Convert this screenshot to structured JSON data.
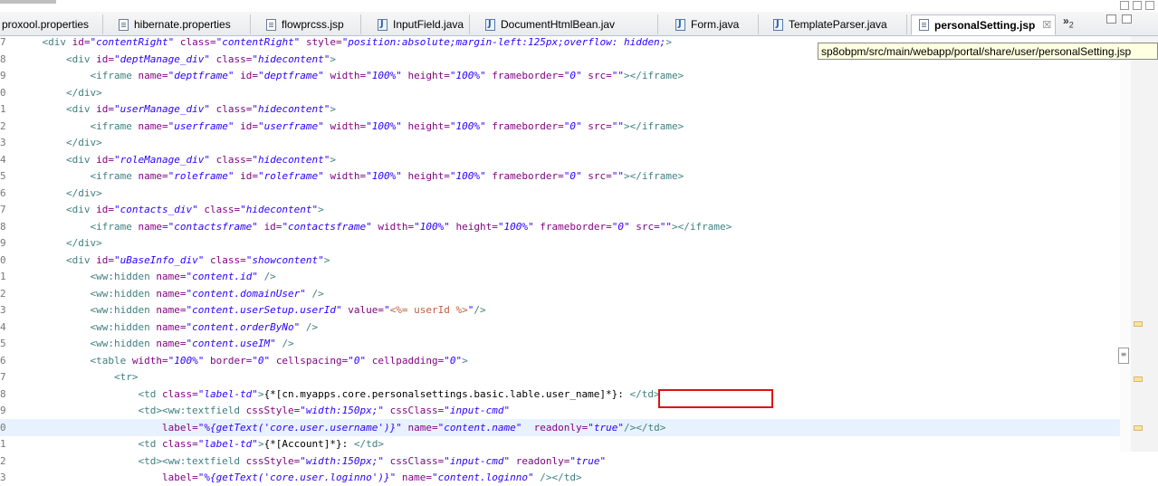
{
  "tabs": [
    {
      "label": "proxool.properties",
      "icon": "properties-file-icon",
      "icon_class": "props",
      "active": false
    },
    {
      "label": "hibernate.properties",
      "icon": "properties-file-icon",
      "icon_class": "props",
      "active": false
    },
    {
      "label": "flowprcss.jsp",
      "icon": "jsp-file-icon",
      "icon_class": "jsp",
      "active": false
    },
    {
      "label": "InputField.java",
      "icon": "java-file-icon",
      "icon_class": "java",
      "active": false
    },
    {
      "label": "DocumentHtmlBean.jav",
      "icon": "java-file-icon",
      "icon_class": "java",
      "active": false
    },
    {
      "label": "Form.java",
      "icon": "java-file-icon",
      "icon_class": "java",
      "active": false
    },
    {
      "label": "TemplateParser.java",
      "icon": "java-file-icon",
      "icon_class": "java",
      "active": false
    },
    {
      "label": "personalSetting.jsp",
      "icon": "jsp-file-icon",
      "icon_class": "jsp",
      "active": true,
      "close": "☒"
    }
  ],
  "overflow": {
    "chevron": "»",
    "count": "2"
  },
  "tooltip": "sp8obpm/src/main/webapp/portal/share/user/personalSetting.jsp",
  "lines": [
    {
      "num": "7",
      "tokens": [
        [
          "t",
          "    "
        ],
        [
          "tg",
          "<div "
        ],
        [
          "at",
          "id="
        ],
        [
          "vl",
          "\"contentRight\" "
        ],
        [
          "at",
          "class="
        ],
        [
          "vl",
          "\"contentRight\" "
        ],
        [
          "at",
          "style="
        ],
        [
          "vl",
          "\"position:absolute;margin-left:125px;overflow: hidden;"
        ],
        [
          "tg",
          ">"
        ]
      ]
    },
    {
      "num": "8",
      "tokens": [
        [
          "t",
          "        "
        ],
        [
          "tg",
          "<div "
        ],
        [
          "at",
          "id="
        ],
        [
          "vl",
          "\"deptManage_div\" "
        ],
        [
          "at",
          "class="
        ],
        [
          "vl",
          "\"hidecontent\""
        ],
        [
          "tg",
          ">"
        ]
      ]
    },
    {
      "num": "9",
      "tokens": [
        [
          "t",
          "            "
        ],
        [
          "tg",
          "<iframe "
        ],
        [
          "at",
          "name="
        ],
        [
          "vl",
          "\"deptframe\" "
        ],
        [
          "at",
          "id="
        ],
        [
          "vl",
          "\"deptframe\" "
        ],
        [
          "at",
          "width="
        ],
        [
          "vl",
          "\"100%\" "
        ],
        [
          "at",
          "height="
        ],
        [
          "vl",
          "\"100%\" "
        ],
        [
          "at",
          "frameborder="
        ],
        [
          "vl",
          "\"0\" "
        ],
        [
          "at",
          "src="
        ],
        [
          "vl",
          "\"\""
        ],
        [
          "tg",
          "></iframe>"
        ]
      ]
    },
    {
      "num": "0",
      "tokens": [
        [
          "t",
          "        "
        ],
        [
          "tg",
          "</div>"
        ]
      ]
    },
    {
      "num": "1",
      "tokens": [
        [
          "t",
          "        "
        ],
        [
          "tg",
          "<div "
        ],
        [
          "at",
          "id="
        ],
        [
          "vl",
          "\"userManage_div\" "
        ],
        [
          "at",
          "class="
        ],
        [
          "vl",
          "\"hidecontent\""
        ],
        [
          "tg",
          ">"
        ]
      ]
    },
    {
      "num": "2",
      "tokens": [
        [
          "t",
          "            "
        ],
        [
          "tg",
          "<iframe "
        ],
        [
          "at",
          "name="
        ],
        [
          "vl",
          "\"userframe\" "
        ],
        [
          "at",
          "id="
        ],
        [
          "vl",
          "\"userframe\" "
        ],
        [
          "at",
          "width="
        ],
        [
          "vl",
          "\"100%\" "
        ],
        [
          "at",
          "height="
        ],
        [
          "vl",
          "\"100%\" "
        ],
        [
          "at",
          "frameborder="
        ],
        [
          "vl",
          "\"0\" "
        ],
        [
          "at",
          "src="
        ],
        [
          "vl",
          "\"\""
        ],
        [
          "tg",
          "></iframe>"
        ]
      ]
    },
    {
      "num": "3",
      "tokens": [
        [
          "t",
          "        "
        ],
        [
          "tg",
          "</div>"
        ]
      ]
    },
    {
      "num": "4",
      "tokens": [
        [
          "t",
          "        "
        ],
        [
          "tg",
          "<div "
        ],
        [
          "at",
          "id="
        ],
        [
          "vl",
          "\"roleManage_div\" "
        ],
        [
          "at",
          "class="
        ],
        [
          "vl",
          "\"hidecontent\""
        ],
        [
          "tg",
          ">"
        ]
      ]
    },
    {
      "num": "5",
      "tokens": [
        [
          "t",
          "            "
        ],
        [
          "tg",
          "<iframe "
        ],
        [
          "at",
          "name="
        ],
        [
          "vl",
          "\"roleframe\" "
        ],
        [
          "at",
          "id="
        ],
        [
          "vl",
          "\"roleframe\" "
        ],
        [
          "at",
          "width="
        ],
        [
          "vl",
          "\"100%\" "
        ],
        [
          "at",
          "height="
        ],
        [
          "vl",
          "\"100%\" "
        ],
        [
          "at",
          "frameborder="
        ],
        [
          "vl",
          "\"0\" "
        ],
        [
          "at",
          "src="
        ],
        [
          "vl",
          "\"\""
        ],
        [
          "tg",
          "></iframe>"
        ]
      ]
    },
    {
      "num": "6",
      "tokens": [
        [
          "t",
          "        "
        ],
        [
          "tg",
          "</div>"
        ]
      ]
    },
    {
      "num": "7",
      "tokens": [
        [
          "t",
          "        "
        ],
        [
          "tg",
          "<div "
        ],
        [
          "at",
          "id="
        ],
        [
          "vl",
          "\"contacts_div\" "
        ],
        [
          "at",
          "class="
        ],
        [
          "vl",
          "\"hidecontent\""
        ],
        [
          "tg",
          ">"
        ]
      ]
    },
    {
      "num": "8",
      "tokens": [
        [
          "t",
          "            "
        ],
        [
          "tg",
          "<iframe "
        ],
        [
          "at",
          "name="
        ],
        [
          "vl",
          "\"contactsframe\" "
        ],
        [
          "at",
          "id="
        ],
        [
          "vl",
          "\"contactsframe\" "
        ],
        [
          "at",
          "width="
        ],
        [
          "vl",
          "\"100%\" "
        ],
        [
          "at",
          "height="
        ],
        [
          "vl",
          "\"100%\" "
        ],
        [
          "at",
          "frameborder="
        ],
        [
          "vl",
          "\"0\" "
        ],
        [
          "at",
          "src="
        ],
        [
          "vl",
          "\"\""
        ],
        [
          "tg",
          "></iframe>"
        ]
      ]
    },
    {
      "num": "9",
      "tokens": [
        [
          "t",
          "        "
        ],
        [
          "tg",
          "</div>"
        ]
      ]
    },
    {
      "num": "0",
      "tokens": [
        [
          "t",
          "        "
        ],
        [
          "tg",
          "<div "
        ],
        [
          "at",
          "id="
        ],
        [
          "vl",
          "\"uBaseInfo_div\" "
        ],
        [
          "at",
          "class="
        ],
        [
          "vl",
          "\"showcontent\""
        ],
        [
          "tg",
          ">"
        ]
      ]
    },
    {
      "num": "1",
      "tokens": [
        [
          "t",
          "            "
        ],
        [
          "tg",
          "<ww:hidden "
        ],
        [
          "at",
          "name="
        ],
        [
          "vl",
          "\"content.id\" "
        ],
        [
          "tg",
          "/>"
        ]
      ]
    },
    {
      "num": "2",
      "tokens": [
        [
          "t",
          "            "
        ],
        [
          "tg",
          "<ww:hidden "
        ],
        [
          "at",
          "name="
        ],
        [
          "vl",
          "\"content.domainUser\" "
        ],
        [
          "tg",
          "/>"
        ]
      ]
    },
    {
      "num": "3",
      "tokens": [
        [
          "t",
          "            "
        ],
        [
          "tg",
          "<ww:hidden "
        ],
        [
          "at",
          "name="
        ],
        [
          "vl",
          "\"content.userSetup.userId\" "
        ],
        [
          "at",
          "value="
        ],
        [
          "vl",
          "\""
        ],
        [
          "sc",
          "<%= userId %>"
        ],
        [
          "vl",
          "\""
        ],
        [
          "tg",
          "/>"
        ]
      ]
    },
    {
      "num": "4",
      "tokens": [
        [
          "t",
          "            "
        ],
        [
          "tg",
          "<ww:hidden "
        ],
        [
          "at",
          "name="
        ],
        [
          "vl",
          "\"content.orderByNo\" "
        ],
        [
          "tg",
          "/>"
        ]
      ]
    },
    {
      "num": "5",
      "tokens": [
        [
          "t",
          "            "
        ],
        [
          "tg",
          "<ww:hidden "
        ],
        [
          "at",
          "name="
        ],
        [
          "vl",
          "\"content.useIM\" "
        ],
        [
          "tg",
          "/>"
        ]
      ]
    },
    {
      "num": "6",
      "tokens": [
        [
          "t",
          "            "
        ],
        [
          "tg",
          "<table "
        ],
        [
          "at",
          "width="
        ],
        [
          "vl",
          "\"100%\" "
        ],
        [
          "at",
          "border="
        ],
        [
          "vl",
          "\"0\" "
        ],
        [
          "at",
          "cellspacing="
        ],
        [
          "vl",
          "\"0\" "
        ],
        [
          "at",
          "cellpadding="
        ],
        [
          "vl",
          "\"0\""
        ],
        [
          "tg",
          ">"
        ]
      ]
    },
    {
      "num": "7",
      "tokens": [
        [
          "t",
          "                "
        ],
        [
          "tg",
          "<tr>"
        ]
      ]
    },
    {
      "num": "8",
      "tokens": [
        [
          "t",
          "                    "
        ],
        [
          "tg",
          "<td "
        ],
        [
          "at",
          "class="
        ],
        [
          "vl",
          "\"label-td\""
        ],
        [
          "tg",
          ">"
        ],
        [
          "t",
          "{*[cn.myapps.core.personalsettings.basic.lable.user_name]*}: "
        ],
        [
          "tg",
          "</td>"
        ]
      ]
    },
    {
      "num": "9",
      "tokens": [
        [
          "t",
          "                    "
        ],
        [
          "tg",
          "<td><ww:textfield "
        ],
        [
          "at",
          "cssStyle="
        ],
        [
          "vl",
          "\"width:150px;\" "
        ],
        [
          "at",
          "cssClass="
        ],
        [
          "vl",
          "\"input-cmd\""
        ]
      ]
    },
    {
      "num": "0",
      "current": true,
      "tokens": [
        [
          "t",
          "                        "
        ],
        [
          "at",
          "label="
        ],
        [
          "vl",
          "\"%{getText('core.user.username')}\" "
        ],
        [
          "at",
          "name="
        ],
        [
          "vl",
          "\"content.name\"  "
        ],
        [
          "at",
          "readonly="
        ],
        [
          "vl",
          "\"true\""
        ],
        [
          "tg",
          "/></td>"
        ]
      ]
    },
    {
      "num": "1",
      "tokens": [
        [
          "t",
          "                    "
        ],
        [
          "tg",
          "<td "
        ],
        [
          "at",
          "class="
        ],
        [
          "vl",
          "\"label-td\""
        ],
        [
          "tg",
          ">"
        ],
        [
          "t",
          "{*[Account]*}: "
        ],
        [
          "tg",
          "</td>"
        ]
      ]
    },
    {
      "num": "2",
      "tokens": [
        [
          "t",
          "                    "
        ],
        [
          "tg",
          "<td><ww:textfield "
        ],
        [
          "at",
          "cssStyle="
        ],
        [
          "vl",
          "\"width:150px;\" "
        ],
        [
          "at",
          "cssClass="
        ],
        [
          "vl",
          "\"input-cmd\" "
        ],
        [
          "at",
          "readonly="
        ],
        [
          "vl",
          "\"true\""
        ]
      ]
    },
    {
      "num": "3",
      "tokens": [
        [
          "t",
          "                        "
        ],
        [
          "at",
          "label="
        ],
        [
          "vl",
          "\"%{getText('core.user.loginno')}\" "
        ],
        [
          "at",
          "name="
        ],
        [
          "vl",
          "\"content.loginno\" "
        ],
        [
          "tg",
          "/></td>"
        ]
      ]
    }
  ],
  "colors": {
    "tag": "#3f7f7f",
    "attr": "#7f007f",
    "value": "#2a00ff",
    "scriptlet": "#bf5f3f",
    "highlight": "#e01010"
  }
}
